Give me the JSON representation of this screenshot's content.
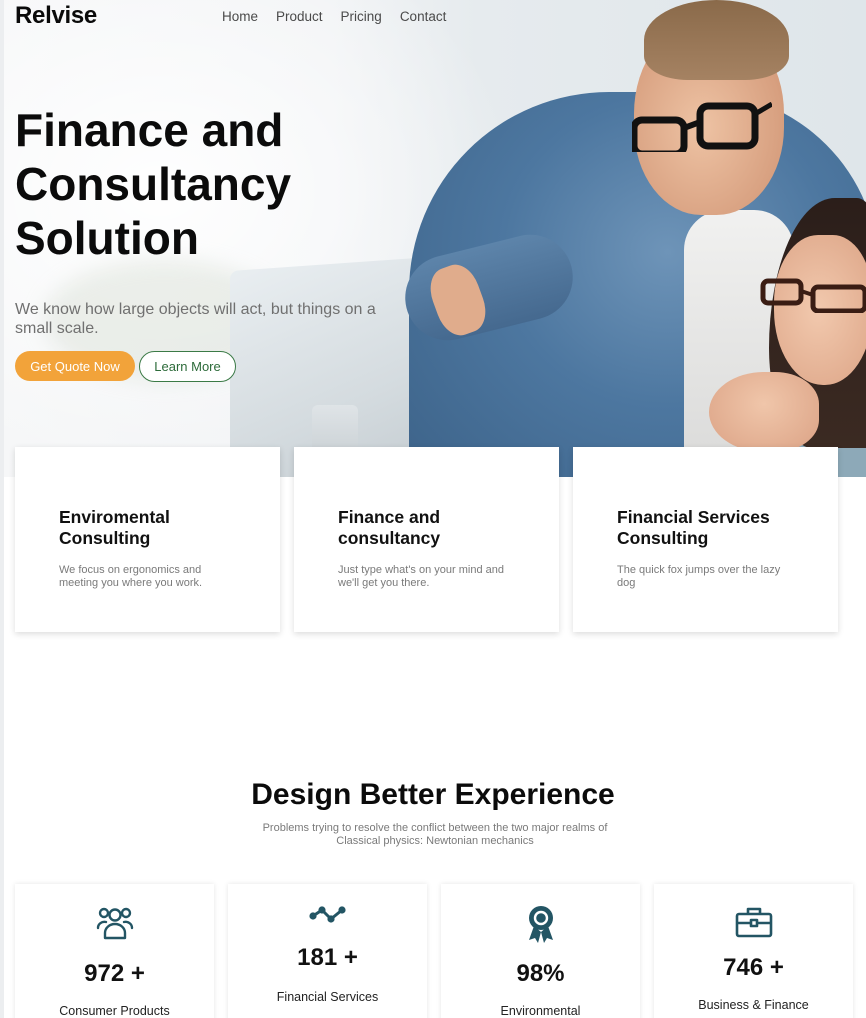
{
  "brand": "Relvise",
  "nav": [
    "Home",
    "Product",
    "Pricing",
    "Contact"
  ],
  "hero": {
    "title_lines": [
      "Finance and",
      "Consultancy",
      "Solution"
    ],
    "subtitle": "We know how large objects will act, but things on a small scale.",
    "primary_button": "Get Quote Now",
    "secondary_button": "Learn More"
  },
  "cards": [
    {
      "title": "Enviromental Consulting",
      "text": "We focus on ergonomics and meeting you where you work."
    },
    {
      "title": "Finance and consultancy",
      "text": "Just type what's on your mind and we'll get you there."
    },
    {
      "title": "Financial Services Consulting",
      "text": "The quick fox jumps over the lazy dog"
    }
  ],
  "section": {
    "title": "Design Better Experience",
    "subtitle": "Problems trying to resolve the conflict between the two major realms of Classical physics: Newtonian mechanics"
  },
  "stats": [
    {
      "icon": "users-icon",
      "value": "972 +",
      "label": "Consumer Products"
    },
    {
      "icon": "trend-icon",
      "value": "181 +",
      "label": "Financial Services"
    },
    {
      "icon": "award-icon",
      "value": "98%",
      "label": "Environmental"
    },
    {
      "icon": "briefcase-icon",
      "value": "746 +",
      "label": "Business & Finance"
    }
  ],
  "colors": {
    "accent": "#f2a33a",
    "green": "#3b7a46",
    "icon": "#235564"
  }
}
